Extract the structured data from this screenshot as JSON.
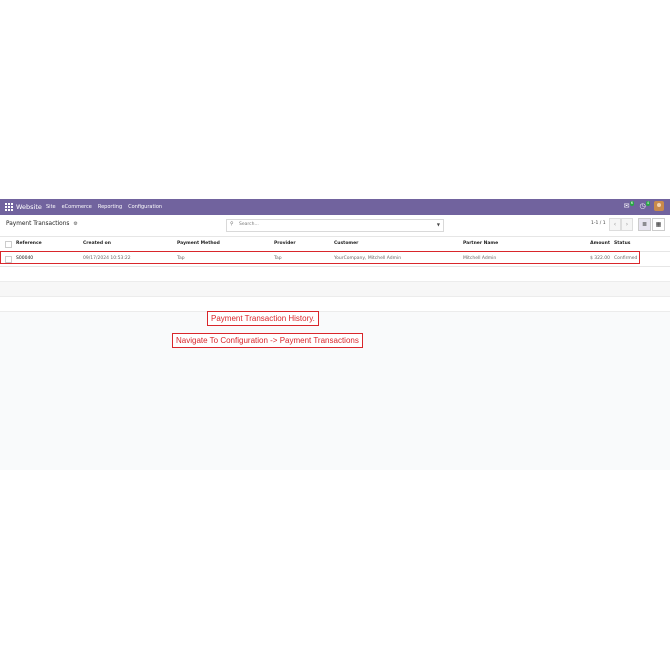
{
  "navbar": {
    "brand": "Website",
    "menu": [
      "Site",
      "eCommerce",
      "Reporting",
      "Configuration"
    ],
    "messages_badge": "6",
    "activities_badge": "4"
  },
  "control": {
    "breadcrumb": "Payment Transactions",
    "search_placeholder": "Search...",
    "pager": "1-1 / 1"
  },
  "table": {
    "headers": [
      "Reference",
      "Created on",
      "Payment Method",
      "Provider",
      "Customer",
      "Partner Name",
      "Amount",
      "Status"
    ],
    "rows": [
      {
        "reference": "S00040",
        "created_on": "09/17/2024 10:53:22",
        "payment_method": "Tap",
        "provider": "Tap",
        "customer": "YourCompany, Mitchell Admin",
        "partner_name": "Mitchell Admin",
        "amount": "$ 322.00",
        "status": "Confirmed"
      }
    ]
  },
  "annotations": {
    "history": "Payment Transaction History.",
    "navigate": "Navigate To Configuration -> Payment Transactions"
  },
  "colors": {
    "navbar": "#71639e",
    "highlight": "#d9262b"
  }
}
